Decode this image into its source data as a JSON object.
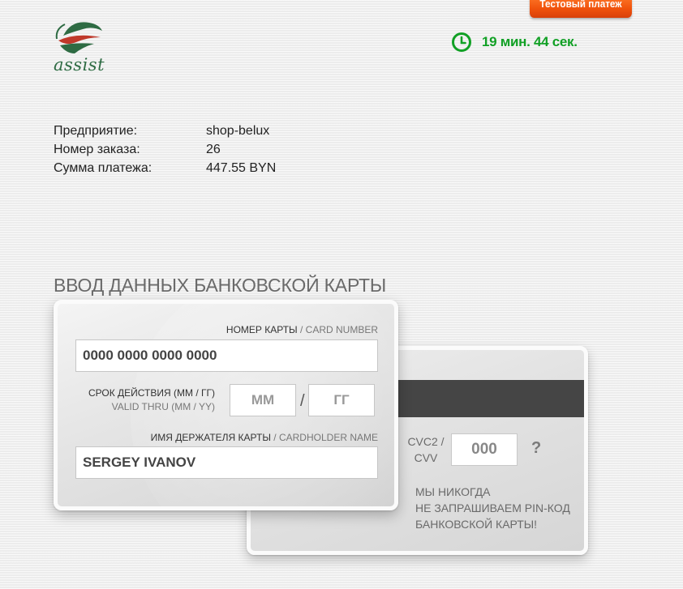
{
  "test_badge": "Тестовый платеж",
  "logo": {
    "text": "assist"
  },
  "timer": {
    "text": "19 мин. 44 сек.",
    "icon": "clock-icon",
    "color": "#11a025"
  },
  "order_info": [
    {
      "label": "Предприятие:",
      "value": "shop-belux"
    },
    {
      "label": "Номер заказа:",
      "value": "26"
    },
    {
      "label": "Сумма платежа:",
      "value": "447.55 BYN"
    }
  ],
  "section_title": "ВВОД ДАННЫХ БАНКОВСКОЙ КАРТЫ",
  "card_front": {
    "card_number_label": "НОМЕР КАРТЫ",
    "card_number_label_en": " / CARD NUMBER",
    "card_number_placeholder": "0000 0000 0000 0000",
    "expiry_label": "СРОК ДЕЙСТВИЯ (ММ / ГГ)",
    "expiry_label_en": "VALID THRU (MM / YY)",
    "month_placeholder": "ММ",
    "year_placeholder": "ГГ",
    "slash": "/",
    "holder_label": "ИМЯ ДЕРЖАТЕЛЯ КАРТЫ",
    "holder_label_en": " / CARDHOLDER NAME",
    "holder_value": "SERGEY IVANOV"
  },
  "card_back": {
    "cvc_label": "CVC2 / CVV",
    "cvc_placeholder": "000",
    "help": "?",
    "pin_warning": "МЫ НИКОГДА\nНЕ ЗАПРАШИВАЕМ PIN-КОД\nБАНКОВСКОЙ КАРТЫ!"
  },
  "colors": {
    "badge": "#f0520c",
    "logo_green": "#2e6b43",
    "logo_red": "#c0392b",
    "stripe": "#454545"
  }
}
